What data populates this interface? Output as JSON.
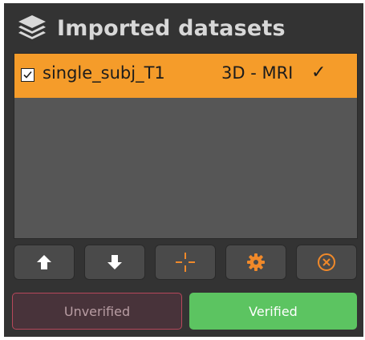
{
  "panel": {
    "title": "Imported datasets",
    "title_icon": "layers-icon"
  },
  "datasets": [
    {
      "name": "single_subj_T1",
      "type": "3D - MRI",
      "checked": true,
      "verified_mark": "✓",
      "selected": true
    }
  ],
  "toolbar": {
    "buttons": [
      {
        "name": "move-up",
        "icon": "arrow-up-icon"
      },
      {
        "name": "move-down",
        "icon": "arrow-down-icon"
      },
      {
        "name": "center",
        "icon": "crosshair-icon"
      },
      {
        "name": "settings",
        "icon": "gear-icon"
      },
      {
        "name": "remove",
        "icon": "close-circle-icon"
      }
    ]
  },
  "status_buttons": {
    "unverified_label": "Unverified",
    "verified_label": "Verified"
  },
  "colors": {
    "panel_bg": "#333333",
    "list_bg": "#565656",
    "selected_row": "#f59c2a",
    "accent_orange": "#f0892a",
    "verified_green": "#5cc461",
    "unverified_border": "#b7475b"
  }
}
